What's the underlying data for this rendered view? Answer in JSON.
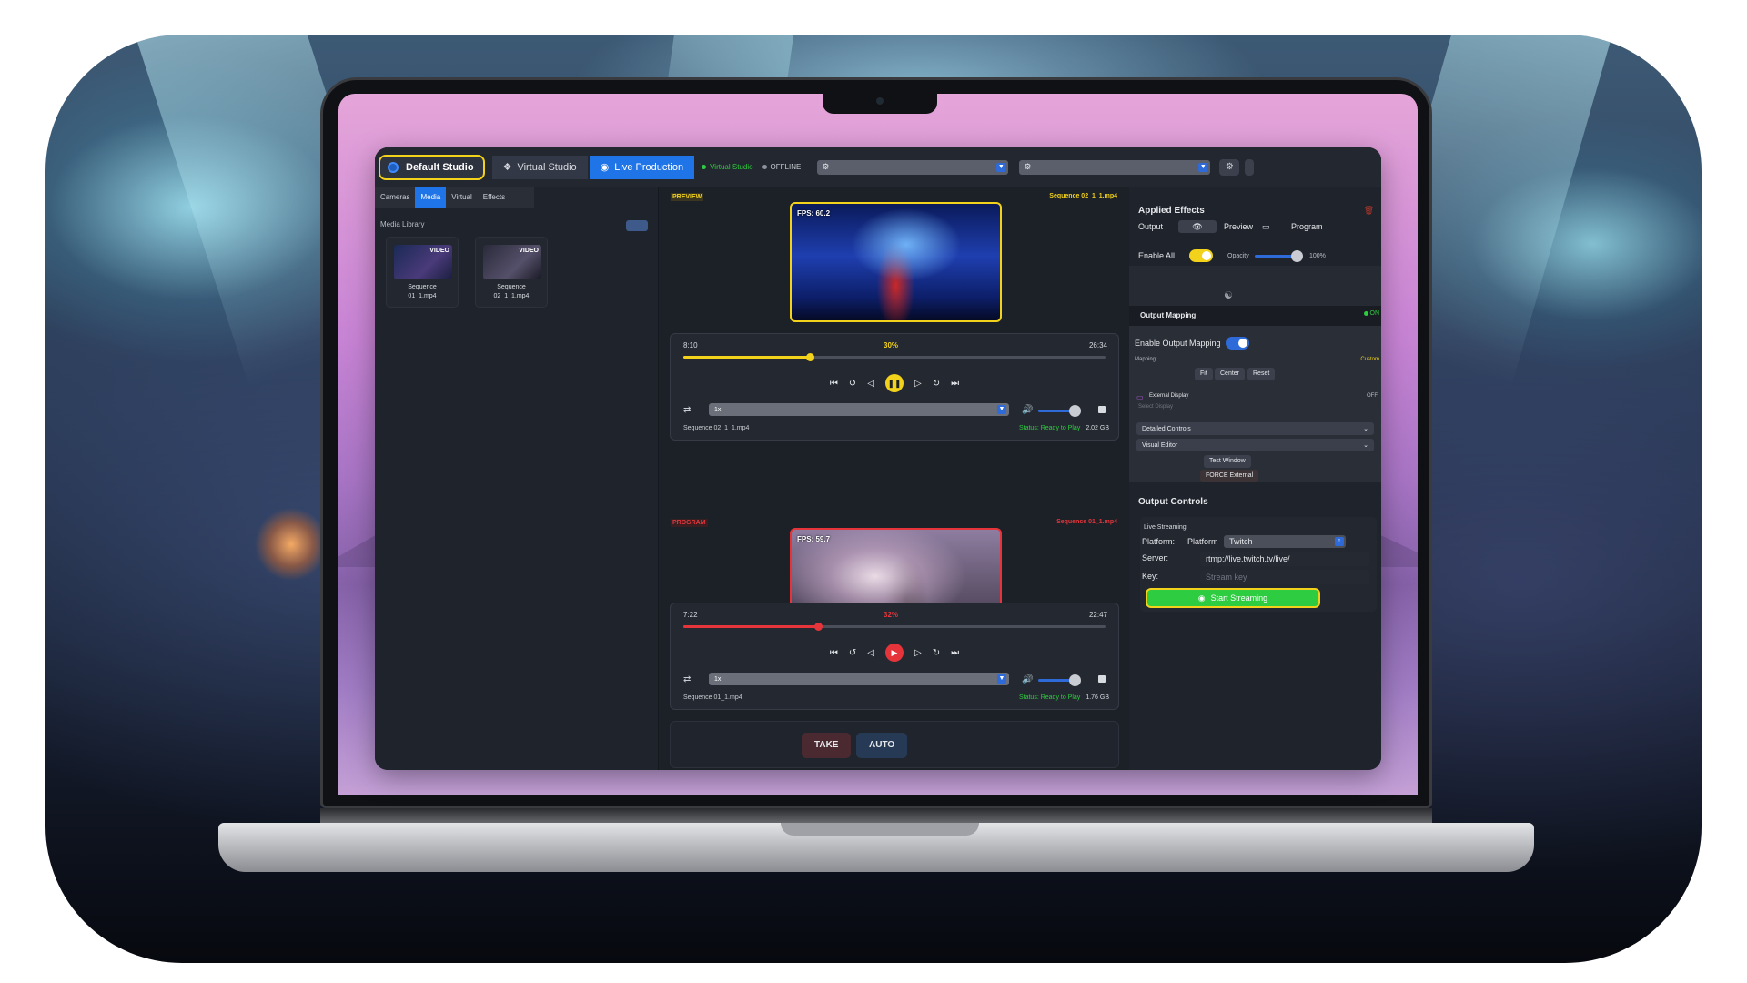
{
  "app": {
    "studio_label": "Default Studio",
    "tabs": [
      {
        "label": "Virtual Studio"
      },
      {
        "label": "Live Production"
      }
    ],
    "status_virtual": "Virtual Studio",
    "status_offline": "OFFLINE"
  },
  "left": {
    "tabs": [
      "Cameras",
      "Media",
      "Virtual",
      "Effects"
    ],
    "library_title": "Media Library",
    "items": [
      {
        "tag": "VIDEO",
        "name_line1": "Sequence",
        "name_line2": "01_1.mp4"
      },
      {
        "tag": "VIDEO",
        "name_line1": "Sequence",
        "name_line2": "02_1_1.mp4"
      }
    ]
  },
  "preview": {
    "label": "PREVIEW",
    "file_top": "Sequence 02_1_1.mp4",
    "fps": "FPS: 60.2",
    "time_current": "8:10",
    "progress_label": "30%",
    "progress": 0.3,
    "time_total": "26:34",
    "speed": "1x",
    "file": "Sequence 02_1_1.mp4",
    "status": "Status: Ready to Play",
    "size": "2.02 GB"
  },
  "program": {
    "label": "PROGRAM",
    "file_top": "Sequence 01_1.mp4",
    "fps": "FPS: 59.7",
    "time_current": "7:22",
    "progress_label": "32%",
    "progress": 0.32,
    "time_total": "22:47",
    "speed": "1x",
    "file": "Sequence 01_1.mp4",
    "status": "Status: Ready to Play",
    "size": "1.76 GB"
  },
  "take": {
    "take_label": "TAKE",
    "auto_label": "AUTO"
  },
  "effects": {
    "title": "Applied Effects",
    "output_label": "Output",
    "preview_label": "Preview",
    "program_label": "Program",
    "enable_all": "Enable All",
    "opacity_label": "Opacity",
    "opacity_value": "100%"
  },
  "mapping": {
    "title": "Output Mapping",
    "state": "ON",
    "enable_label": "Enable Output Mapping",
    "mapping_label": "Mapping:",
    "mapping_mode": "Custom",
    "fit": "Fit",
    "center": "Center",
    "reset": "Reset",
    "external_label": "External Display",
    "external_state": "OFF",
    "select_display": "Select Display",
    "detailed_controls": "Detailed Controls",
    "visual_editor": "Visual Editor",
    "test_window": "Test Window",
    "force_external": "FORCE External"
  },
  "output": {
    "title": "Output Controls",
    "live_label": "Live Streaming",
    "platform_label": "Platform:",
    "platform_inner": "Platform",
    "platform_value": "Twitch",
    "server_label": "Server:",
    "server_value": "rtmp://live.twitch.tv/live/",
    "key_label": "Key:",
    "key_placeholder": "Stream key",
    "start_label": "Start Streaming"
  },
  "colors": {
    "accent": "#1f74e8",
    "preview": "#f2d21a",
    "program": "#e5353b",
    "ok": "#2ecc40"
  }
}
